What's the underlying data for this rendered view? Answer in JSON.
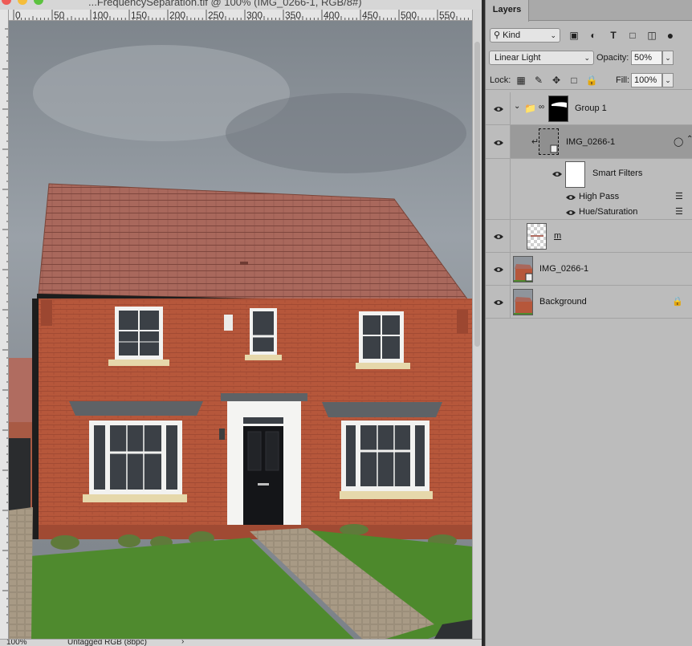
{
  "document": {
    "title": "...FrequencySeparation.tif @ 100% (IMG_0266-1, RGB/8#)",
    "ruler_top_labels": [
      "0",
      "50",
      "100",
      "150",
      "200",
      "250",
      "300",
      "350",
      "400",
      "450",
      "500",
      "550"
    ],
    "status": {
      "zoom": "100%",
      "info": "Untagged RGB (8bpc)",
      "arrow": "›"
    }
  },
  "layers_panel": {
    "tab_label": "Layers",
    "filter": {
      "kind_label": "Kind",
      "icons": [
        "image-filter-icon",
        "adjustment-filter-icon",
        "type-filter-icon",
        "shape-filter-icon",
        "smart-object-filter-icon",
        "filter-toggle-icon"
      ]
    },
    "blend_mode": "Linear Light",
    "opacity_label": "Opacity:",
    "opacity_value": "50%",
    "lock_label": "Lock:",
    "lock_icons": [
      "lock-transparent-icon",
      "lock-paint-icon",
      "lock-position-icon",
      "lock-artboard-icon",
      "lock-all-icon"
    ],
    "fill_label": "Fill:",
    "fill_value": "100%",
    "layers": [
      {
        "name": "Group 1",
        "type": "group",
        "visible": true,
        "expanded": true
      },
      {
        "name": "IMG_0266-1",
        "type": "smart-object",
        "visible": true,
        "selected": true,
        "clipped": true
      },
      {
        "name": "Smart Filters",
        "type": "smart-filters",
        "visible": true
      },
      {
        "name": "High Pass",
        "type": "filter",
        "visible": true
      },
      {
        "name": "Hue/Saturation",
        "type": "filter",
        "visible": true
      },
      {
        "name": "m",
        "type": "pixel",
        "visible": true
      },
      {
        "name": "IMG_0266-1",
        "type": "smart-object",
        "visible": true
      },
      {
        "name": "Background",
        "type": "background",
        "visible": true,
        "locked": true
      }
    ]
  },
  "colors": {
    "selected_row": "#9a9a9a",
    "panel_bg": "#bcbcbc",
    "brick": "#b3543a",
    "roof": "#a5645a",
    "sky": "#8f959c",
    "grass": "#4f8a2e"
  }
}
